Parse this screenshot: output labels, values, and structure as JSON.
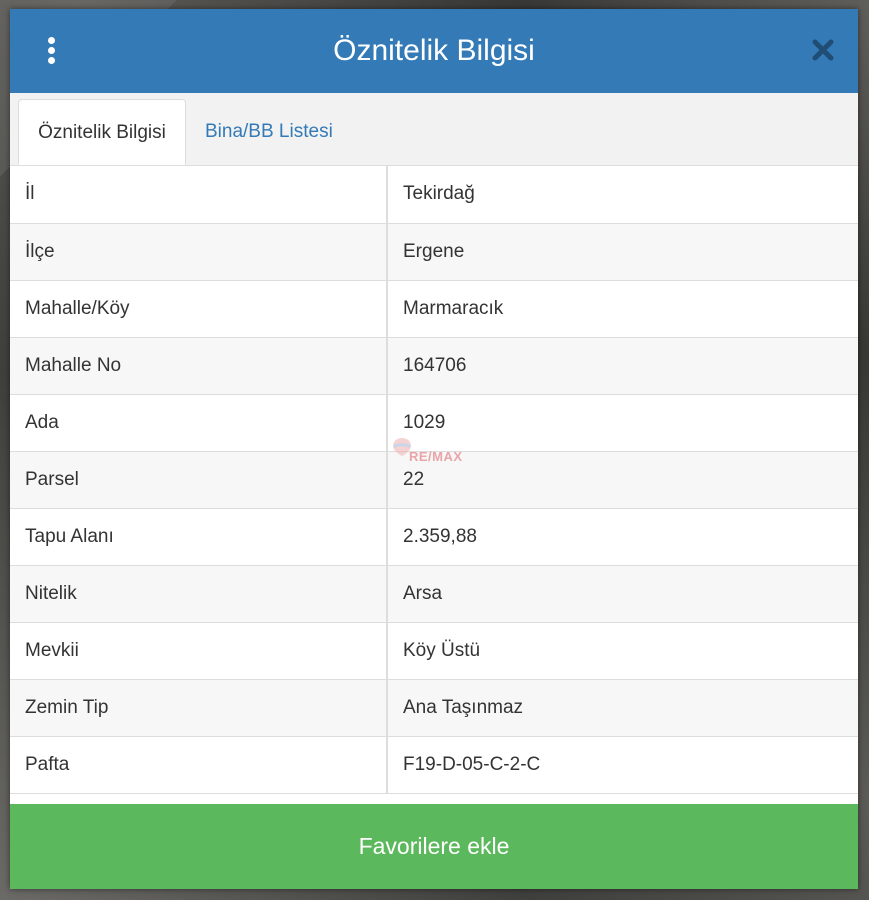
{
  "header": {
    "title": "Öznitelik Bilgisi",
    "menu_icon": "vertical-dots-icon",
    "close_icon": "close-icon",
    "color": "#337ab7"
  },
  "tabs": [
    {
      "label": "Öznitelik Bilgisi",
      "active": true
    },
    {
      "label": "Bina/BB Listesi",
      "active": false
    }
  ],
  "attributes": [
    {
      "key": "İl",
      "value": "Tekirdağ"
    },
    {
      "key": "İlçe",
      "value": "Ergene"
    },
    {
      "key": "Mahalle/Köy",
      "value": "Marmaracık"
    },
    {
      "key": "Mahalle No",
      "value": "164706"
    },
    {
      "key": "Ada",
      "value": "1029"
    },
    {
      "key": "Parsel",
      "value": "22"
    },
    {
      "key": "Tapu Alanı",
      "value": "2.359,88"
    },
    {
      "key": "Nitelik",
      "value": "Arsa"
    },
    {
      "key": "Mevkii",
      "value": "Köy Üstü"
    },
    {
      "key": "Zemin Tip",
      "value": "Ana Taşınmaz"
    },
    {
      "key": "Pafta",
      "value": "F19-D-05-C-2-C"
    }
  ],
  "watermark": {
    "text": "RE/MAX",
    "icon": "balloon-logo-icon"
  },
  "footer": {
    "button_label": "Favorilere ekle",
    "color": "#5cb85c"
  }
}
